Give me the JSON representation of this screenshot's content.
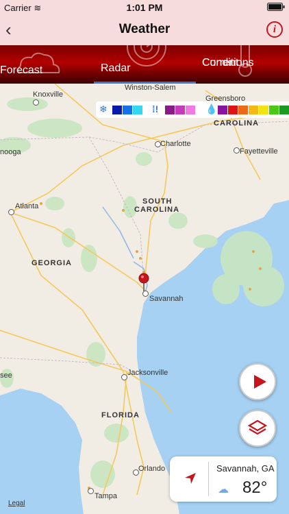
{
  "status_bar": {
    "carrier": "Carrier",
    "time": "1:01 PM",
    "battery": "▭"
  },
  "nav": {
    "title": "Weather",
    "back": "‹",
    "info": "i"
  },
  "tabs": [
    {
      "label": "Forecast"
    },
    {
      "label": "Radar"
    },
    {
      "label_line1": "Current",
      "label_line2": "Conditions"
    }
  ],
  "map": {
    "cities": [
      "Knoxville",
      "Winston-Salem",
      "Greensboro",
      "Charlotte",
      "Fayetteville",
      "Atlanta",
      "Savannah",
      "Jacksonville",
      "Orlando",
      "Tampa"
    ],
    "partial_labels": [
      "nooga",
      "see"
    ],
    "states": [
      "CAROLINA",
      "SOUTH",
      "CAROLINA",
      "GEORGIA",
      "FLORIDA"
    ],
    "legal": "Legal"
  },
  "legend": {
    "snow_colors": [
      "#0a1aa8",
      "#1670e6",
      "#35d6f0"
    ],
    "mix_colors": [
      "#8a1a8a",
      "#c43cb8",
      "#f07ae0"
    ],
    "rain_colors": [
      "#8a12a0",
      "#e01414",
      "#f06a14",
      "#f5b814",
      "#f2e414",
      "#4ac814",
      "#1a9a20"
    ]
  },
  "location_card": {
    "city": "Savannah, GA",
    "temperature": "82°"
  }
}
